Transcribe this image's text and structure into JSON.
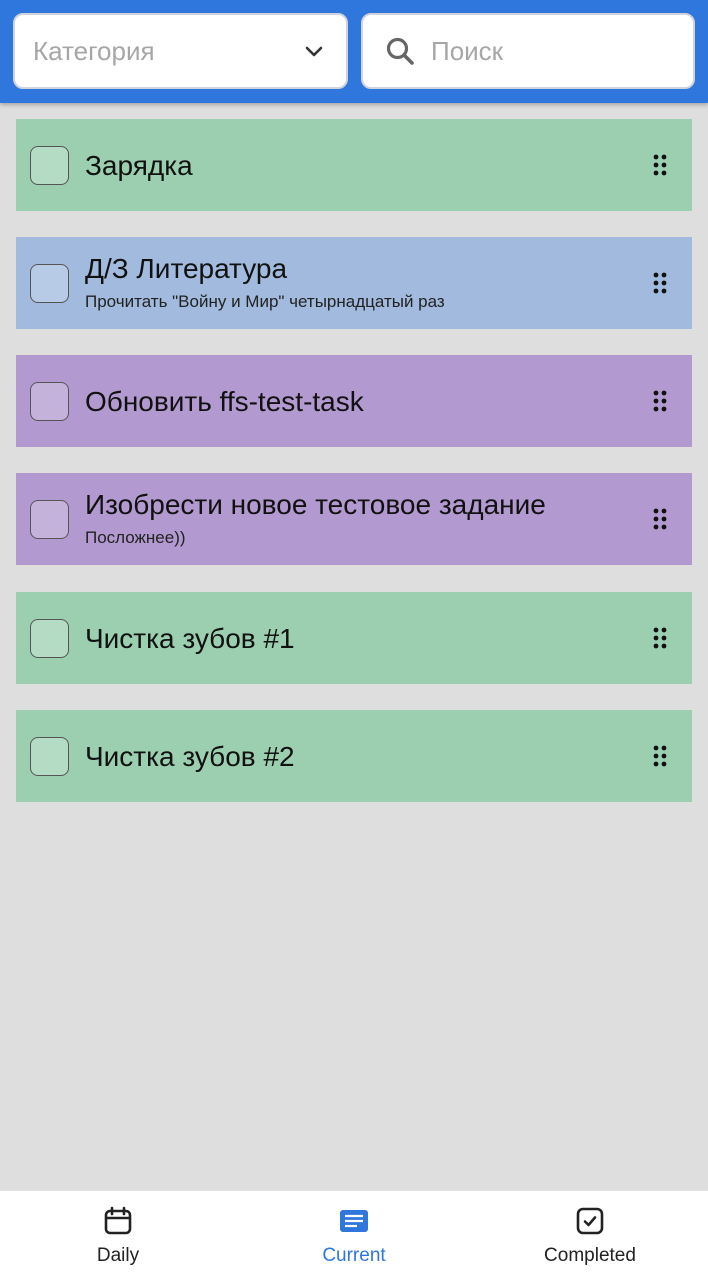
{
  "filters": {
    "category_placeholder": "Категория",
    "search_placeholder": "Поиск"
  },
  "tasks": [
    {
      "title": "Зарядка",
      "subtitle": "",
      "color": "#9bcfb0",
      "checked": false
    },
    {
      "title": "Д/З Литература",
      "subtitle": "Прочитать \"Войну и Мир\" четырнадцатый раз",
      "color": "#a1bade",
      "checked": false
    },
    {
      "title": "Обновить ffs-test-task",
      "subtitle": "",
      "color": "#b299cf",
      "checked": false
    },
    {
      "title": "Изобрести новое тестовое задание",
      "subtitle": "Посложнее))",
      "color": "#b299cf",
      "checked": false
    },
    {
      "title": "Чистка зубов #1",
      "subtitle": "",
      "color": "#9bcfb0",
      "checked": false
    },
    {
      "title": "Чистка зубов #2",
      "subtitle": "",
      "color": "#9bcfb0",
      "checked": false
    }
  ],
  "nav": {
    "items": [
      {
        "label": "Daily",
        "icon": "calendar-icon",
        "active": false
      },
      {
        "label": "Current",
        "icon": "list-icon",
        "active": true
      },
      {
        "label": "Completed",
        "icon": "checked-box-icon",
        "active": false
      }
    ]
  },
  "colors": {
    "header": "#2f77dc",
    "accent": "#2f77dc",
    "background": "#dedede"
  }
}
